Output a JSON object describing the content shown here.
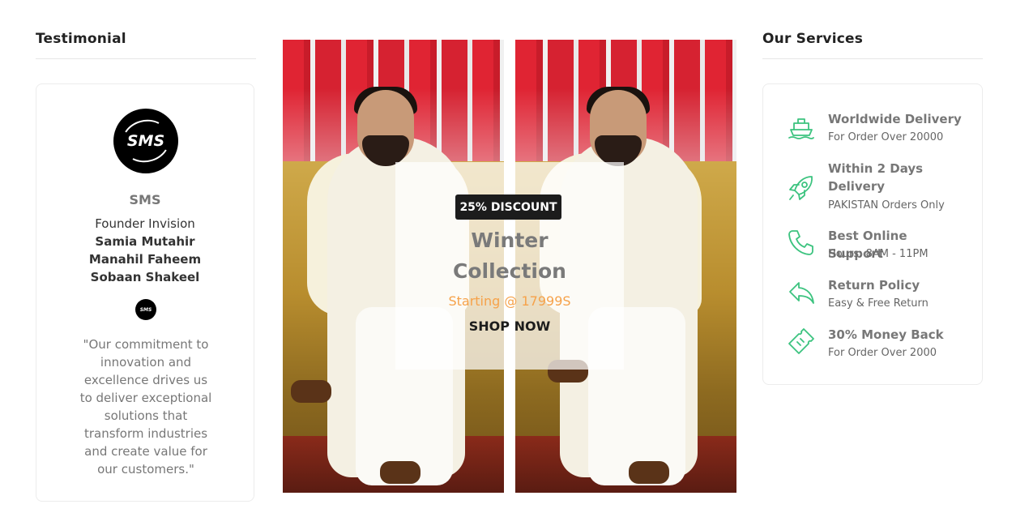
{
  "testimonial": {
    "heading": "Testimonial",
    "logo_text": "SMS",
    "name": "SMS",
    "role": "Founder Invision",
    "members": [
      "Samia Mutahir",
      "Manahil Faheem",
      "Sobaan Shakeel"
    ],
    "quote": "\"Our commitment to innovation and excellence drives us to deliver exceptional solutions that transform industries and create value for our customers.\""
  },
  "banner": {
    "badge": "25% DISCOUNT",
    "title_line1": "Winter",
    "title_line2": "Collection",
    "price": "Starting @ 17999S",
    "cta": "SHOP NOW"
  },
  "services": {
    "heading": "Our Services",
    "accent_color": "#3cc37f",
    "items": [
      {
        "icon": "ship-icon",
        "title": "Worldwide Delivery",
        "subtitle": "For Order Over 20000"
      },
      {
        "icon": "rocket-icon",
        "title": "Within 2 Days Delivery",
        "subtitle": "PAKISTAN Orders Only"
      },
      {
        "icon": "phone-icon",
        "title": "Best Online Support",
        "subtitle": "Hours: 8AM - 11PM"
      },
      {
        "icon": "return-arrow-icon",
        "title": "Return Policy",
        "subtitle": "Easy & Free Return"
      },
      {
        "icon": "ticket-icon",
        "title": "30% Money Back",
        "subtitle": "For Order Over 2000"
      }
    ]
  }
}
